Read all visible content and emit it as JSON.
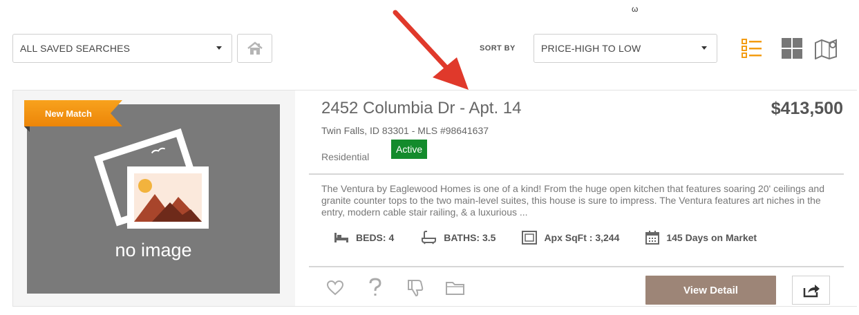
{
  "toolbar": {
    "saved_searches": {
      "selected": "ALL SAVED SEARCHES"
    },
    "sort": {
      "label": "SORT BY",
      "selected": "PRICE-HIGH TO LOW"
    },
    "view_modes": [
      "list-view-icon",
      "grid-view-icon",
      "map-view-icon"
    ],
    "stray_mark": "ω"
  },
  "listing": {
    "badge": "New Match",
    "photo_placeholder": "no image",
    "address": "2452 Columbia Dr - Apt. 14",
    "location": "Twin Falls, ID 83301 - MLS #98641637",
    "type": "Residential",
    "status": "Active",
    "price": "$413,500",
    "description": "The Ventura by Eaglewood Homes is one of a kind! From the huge open kitchen that features soaring 20' ceilings and granite counter tops to the two main-level suites, this house is sure to impress. The Ventura features art niches in the entry, modern cable stair railing, & a luxurious ...",
    "stats": {
      "beds": "BEDS: 4",
      "baths": "BATHS: 3.5",
      "sqft": "Apx SqFt : 3,244",
      "days": "145 Days on Market"
    },
    "actions": [
      "heart-icon",
      "question-icon",
      "thumbs-down-icon",
      "folder-icon"
    ],
    "view_detail": "View Detail"
  },
  "colors": {
    "accent_orange": "#f39c12",
    "status_green": "#138b2c",
    "detail_button": "#9d8577",
    "arrow_red": "#e0392b"
  }
}
